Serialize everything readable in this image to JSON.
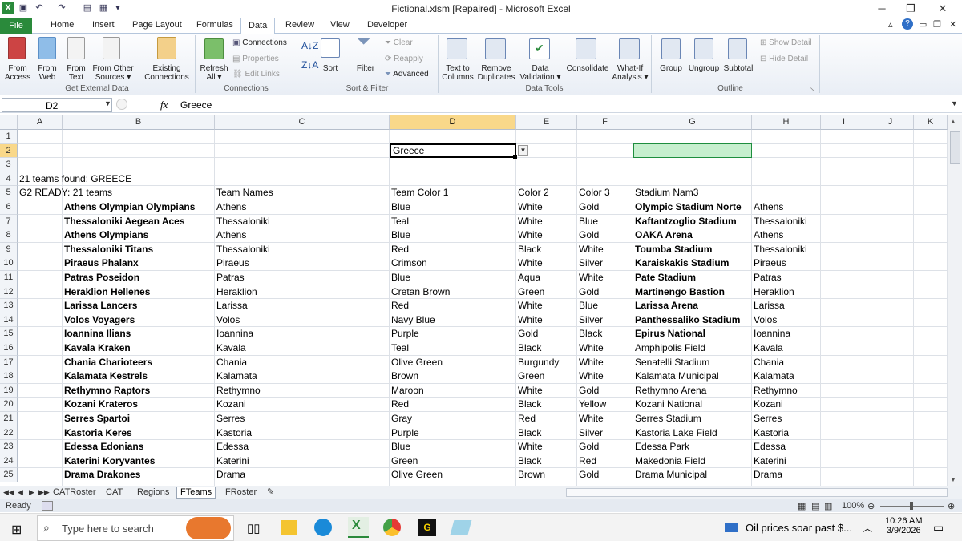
{
  "window": {
    "title": "Fictional.xlsm [Repaired]  -  Microsoft Excel"
  },
  "tabs": [
    "File",
    "Home",
    "Insert",
    "Page Layout",
    "Formulas",
    "Data",
    "Review",
    "View",
    "Developer"
  ],
  "ribbon": {
    "from_access": [
      "From",
      "Access"
    ],
    "from_web": [
      "From",
      "Web"
    ],
    "from_text": [
      "From",
      "Text"
    ],
    "from_other": [
      "From Other",
      "Sources ▾"
    ],
    "existing": [
      "Existing",
      "Connections"
    ],
    "refresh": [
      "Refresh",
      "All ▾"
    ],
    "connections": "Connections",
    "properties": "Properties",
    "edit_links": "Edit Links",
    "sort": "Sort",
    "filter": "Filter",
    "clear": "Clear",
    "reapply": "Reapply",
    "advanced": "Advanced",
    "text_to_columns": [
      "Text to",
      "Columns"
    ],
    "remove_duplicates": [
      "Remove",
      "Duplicates"
    ],
    "data_validation": [
      "Data",
      "Validation ▾"
    ],
    "consolidate": "Consolidate",
    "what_if": [
      "What-If",
      "Analysis ▾"
    ],
    "group": "Group",
    "ungroup": "Ungroup",
    "subtotal": "Subtotal",
    "show_detail": "Show Detail",
    "hide_detail": "Hide Detail",
    "groups": {
      "external": "Get External Data",
      "connections": "Connections",
      "sortfilter": "Sort & Filter",
      "datatools": "Data Tools",
      "outline": "Outline"
    }
  },
  "formula_bar": {
    "name_box": "D2",
    "fx": "fx",
    "value": "Greece"
  },
  "columns": [
    "A",
    "B",
    "C",
    "D",
    "E",
    "F",
    "G",
    "H",
    "I",
    "J",
    "K"
  ],
  "selected_column": "D",
  "rows": [
    "1",
    "2",
    "3",
    "4",
    "5",
    "6",
    "7",
    "8",
    "9",
    "10",
    "11",
    "12",
    "13",
    "14",
    "15",
    "16",
    "17",
    "18",
    "19",
    "20",
    "21",
    "22",
    "23",
    "24",
    "25"
  ],
  "selected_row": "2",
  "cells": {
    "d2": "Greece",
    "a4": "21 teams found: GREECE",
    "a5": "G2 READY: 21 teams",
    "c5": "Team Names",
    "d5": "Team Color 1",
    "e5": "Color 2",
    "f5": "Color 3",
    "g5": "Stadium Nam3"
  },
  "table": [
    [
      "Athens Olympian Olympians",
      "Athens",
      "Blue",
      "White",
      "Gold",
      "Olympic Stadium Norte",
      "Athens",
      true
    ],
    [
      "Thessaloniki Aegean Aces",
      "Thessaloniki",
      "Teal",
      "White",
      "Blue",
      "Kaftantzoglio Stadium",
      "Thessaloniki",
      true
    ],
    [
      "Athens Olympians",
      "Athens",
      "Blue",
      "White",
      "Gold",
      "OAKA Arena",
      "Athens",
      true
    ],
    [
      "Thessaloniki Titans",
      "Thessaloniki",
      "Red",
      "Black",
      "White",
      "Toumba Stadium",
      "Thessaloniki",
      true
    ],
    [
      "Piraeus Phalanx",
      "Piraeus",
      "Crimson",
      "White",
      "Silver",
      "Karaiskakis Stadium",
      "Piraeus",
      true
    ],
    [
      "Patras Poseidon",
      "Patras",
      "Blue",
      "Aqua",
      "White",
      "Pate Stadium",
      "Patras",
      true
    ],
    [
      "Heraklion Hellenes",
      "Heraklion",
      "Cretan Brown",
      "Green",
      "Gold",
      "Martinengo Bastion",
      "Heraklion",
      true
    ],
    [
      "Larissa Lancers",
      "Larissa",
      "Red",
      "White",
      "Blue",
      "Larissa Arena",
      "Larissa",
      true
    ],
    [
      "Volos Voyagers",
      "Volos",
      "Navy Blue",
      "White",
      "Silver",
      "Panthessaliko Stadium",
      "Volos",
      true
    ],
    [
      "Ioannina Ilians",
      "Ioannina",
      "Purple",
      "Gold",
      "Black",
      "Epirus National",
      "Ioannina",
      true
    ],
    [
      "Kavala Kraken",
      "Kavala",
      "Teal",
      "Black",
      "White",
      "Amphipolis Field",
      "Kavala",
      false
    ],
    [
      "Chania Charioteers",
      "Chania",
      "Olive Green",
      "Burgundy",
      "White",
      "Senatelli Stadium",
      "Chania",
      false
    ],
    [
      "Kalamata Kestrels",
      "Kalamata",
      "Brown",
      "Green",
      "White",
      "Kalamata Municipal",
      "Kalamata",
      false
    ],
    [
      "Rethymno Raptors",
      "Rethymno",
      "Maroon",
      "White",
      "Gold",
      "Rethymno Arena",
      "Rethymno",
      false
    ],
    [
      "Kozani Krateros",
      "Kozani",
      "Red",
      "Black",
      "Yellow",
      "Kozani National",
      "Kozani",
      false
    ],
    [
      "Serres Spartoi",
      "Serres",
      "Gray",
      "Red",
      "White",
      "Serres Stadium",
      "Serres",
      false
    ],
    [
      "Kastoria Keres",
      "Kastoria",
      "Purple",
      "Black",
      "Silver",
      "Kastoria Lake Field",
      "Kastoria",
      false
    ],
    [
      "Edessa Edonians",
      "Edessa",
      "Blue",
      "White",
      "Gold",
      "Edessa Park",
      "Edessa",
      false
    ],
    [
      "Katerini Koryvantes",
      "Katerini",
      "Green",
      "Black",
      "Red",
      "Makedonia Field",
      "Katerini",
      false
    ],
    [
      "Drama Drakones",
      "Drama",
      "Olive Green",
      "Brown",
      "Gold",
      "Drama Municipal",
      "Drama",
      false
    ]
  ],
  "sheets": [
    "CATRoster",
    "CAT",
    "Regions",
    "FTeams",
    "FRoster"
  ],
  "active_sheet": "FTeams",
  "status": {
    "ready": "Ready",
    "zoom": "100%"
  },
  "taskbar": {
    "search": "Type here to search",
    "news": "Oil prices soar past $...",
    "time": "10:26 AM",
    "date": "3/9/2026"
  },
  "colors": {
    "excel_green": "#2a8a3b",
    "selection": "#f9d88a",
    "g2_fill": "#c6efce"
  }
}
